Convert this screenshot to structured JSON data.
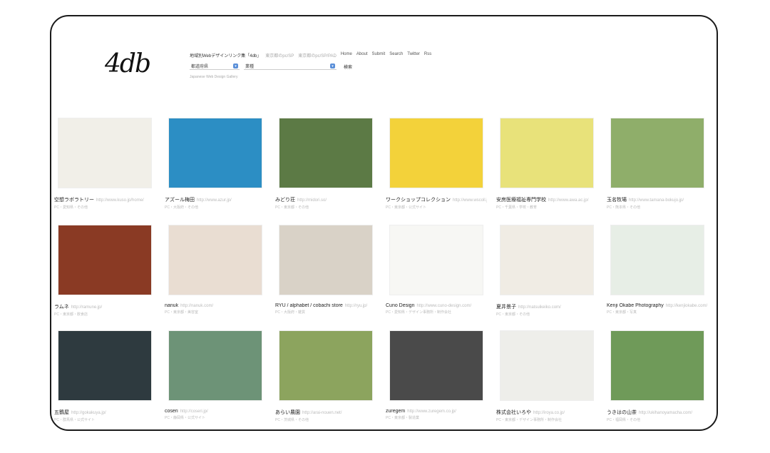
{
  "brand": {
    "logo_text": "4db"
  },
  "header": {
    "site_title": "地域別Webデザインリンク集「4db」",
    "nav_faint": [
      "東京都のpc/SP",
      "東京都のpc/SP/PAD"
    ],
    "nav_links": [
      "Home",
      "About",
      "Submit",
      "Search",
      "Twitter",
      "Rss"
    ],
    "pref_select": "都道府県",
    "genre_select": "業種",
    "search_label": "検索",
    "tagline": "Japanese Web Design Gallery"
  },
  "sites": [
    {
      "title": "空想ラボラトリー",
      "url": "http://www.kuso.jp/home/",
      "meta": "PC・愛知県・その他",
      "bg": "#f1efe8"
    },
    {
      "title": "アズール梅田",
      "url": "http://www.azur.jp/",
      "meta": "PC・大阪府・その他",
      "bg": "#2c8ec4"
    },
    {
      "title": "みどり荘",
      "url": "http://midori.so/",
      "meta": "PC・東京都・その他",
      "bg": "#5c7a45"
    },
    {
      "title": "ワークショップコレクション",
      "url": "http://www.wscoll.jp/",
      "meta": "PC・東京都・公式サイト",
      "bg": "#f3d23a"
    },
    {
      "title": "安房医療福祉専門学校",
      "url": "http://www.awa.ac.jp/",
      "meta": "PC・千葉県・学校・教育",
      "bg": "#e8e27a"
    },
    {
      "title": "玉名牧場",
      "url": "http://www.tamana-bokujo.jp/",
      "meta": "PC・熊本県・その他",
      "bg": "#8fae6a"
    },
    {
      "title": "ラムネ",
      "url": "http://ramune.jp/",
      "meta": "PC・東京都・飲食店",
      "bg": "#8a3a24"
    },
    {
      "title": "nanuk",
      "url": "http://nanuk.com/",
      "meta": "PC・東京都・美容室",
      "bg": "#e9ddd2"
    },
    {
      "title": "RYU / alphabet / cobachi store",
      "url": "http://ryu.jp/",
      "meta": "PC・大阪府・雑貨",
      "bg": "#d9d2c7"
    },
    {
      "title": "Cuno Design",
      "url": "http://www.cuno-design.com/",
      "meta": "PC・愛知県・デザイン事務所・制作会社",
      "bg": "#f7f7f4"
    },
    {
      "title": "夏井景子",
      "url": "http://natsuikeiko.com/",
      "meta": "PC・東京都・その他",
      "bg": "#f0ece4"
    },
    {
      "title": "Kenji Okabe Photography",
      "url": "http://kenjiokabe.com/",
      "meta": "PC・東京都・写真",
      "bg": "#e7eee6"
    },
    {
      "title": "五鶴屋",
      "url": "http://gokakuya.jp/",
      "meta": "PC・群馬県・公式サイト",
      "bg": "#2e3a3f"
    },
    {
      "title": "coseri",
      "url": "http://coseri.jp/",
      "meta": "PC・静岡県・公式サイト",
      "bg": "#6d9377"
    },
    {
      "title": "あらい農園",
      "url": "http://arai-nouen.net/",
      "meta": "PC・茨城県・その他",
      "bg": "#8ca45e"
    },
    {
      "title": "zuregem",
      "url": "http://www.zuregem.co.jp/",
      "meta": "PC・東京都・製造業",
      "bg": "#4a4a4a"
    },
    {
      "title": "株式会社いろや",
      "url": "http://iroya.co.jp/",
      "meta": "PC・東京都・デザイン事務所・制作会社",
      "bg": "#eeeeea"
    },
    {
      "title": "うきはの山茶",
      "url": "http://ukihanoyamacha.com/",
      "meta": "PC・福岡県・その他",
      "bg": "#6f9a59"
    }
  ]
}
